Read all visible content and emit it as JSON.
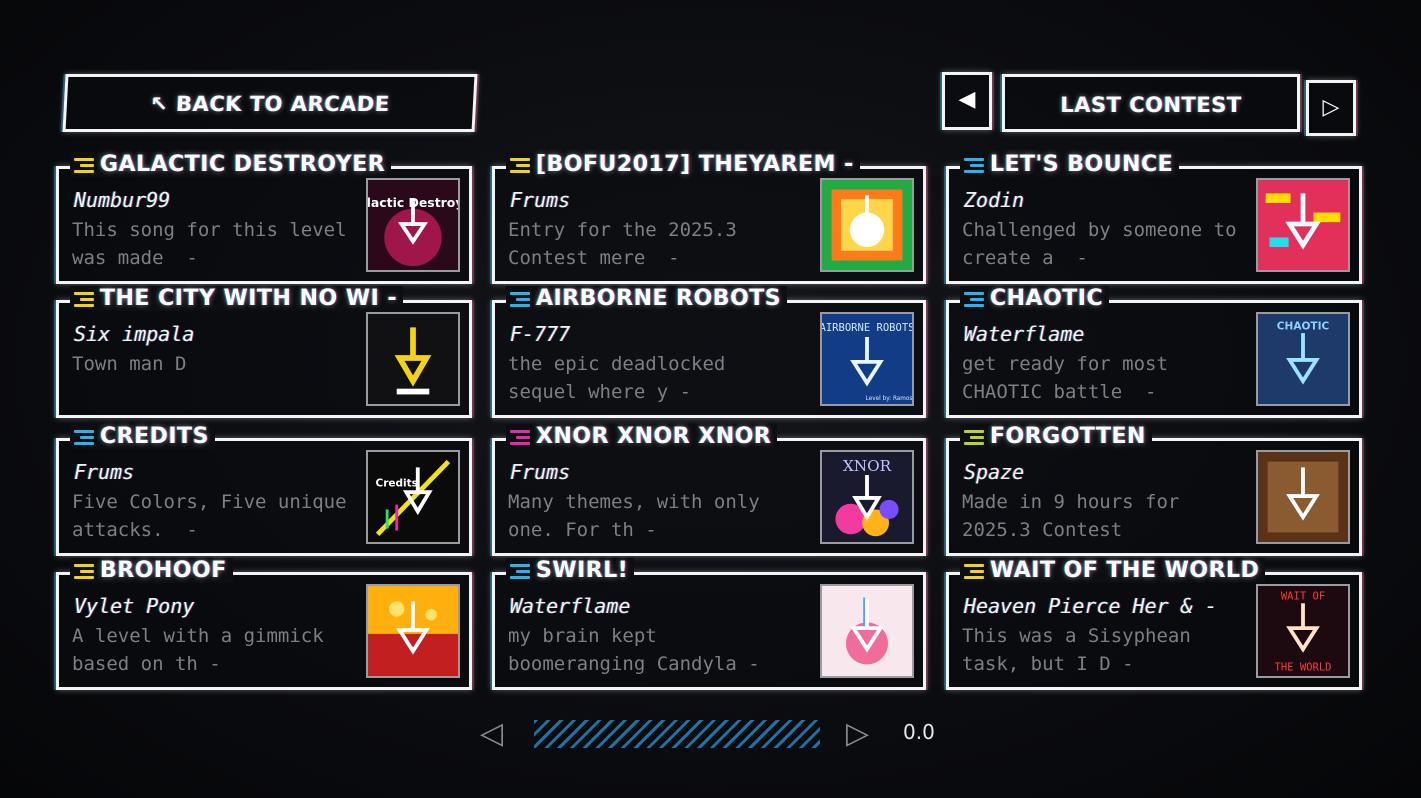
{
  "top": {
    "back_label": "↖ BACK TO ARCADE",
    "prev_glyph": "◀",
    "contest_label": "LAST CONTEST",
    "next_glyph": "▷"
  },
  "levels": [
    {
      "title": "GALACTIC DESTROYER",
      "artist": "Numbur99",
      "desc": "This song for this level\nwas made  -",
      "icon_color": "#f2d21a",
      "art": "galactic"
    },
    {
      "title": "[BOFU2017] THEYAREM -",
      "artist": "Frums",
      "desc": "Entry for the 2025.3\nContest mere  -",
      "icon_color": "#f2d21a",
      "art": "bofu"
    },
    {
      "title": "LET'S BOUNCE",
      "artist": "Zodin",
      "desc": "Challenged by someone to\ncreate a  -",
      "icon_color": "#25b4f0",
      "art": "bounce"
    },
    {
      "title": "THE CITY WITH NO WI -",
      "artist": "Six impala",
      "desc": "Town man D",
      "icon_color": "#f2d21a",
      "art": "city"
    },
    {
      "title": "AIRBORNE ROBOTS",
      "artist": "F-777",
      "desc": "the epic deadlocked\nsequel where y -",
      "icon_color": "#25b4f0",
      "art": "airborne"
    },
    {
      "title": "CHAOTIC",
      "artist": "Waterflame",
      "desc": "get ready for most\nCHAOTIC battle  -",
      "icon_color": "#25b4f0",
      "art": "chaotic"
    },
    {
      "title": "CREDITS",
      "artist": "Frums",
      "desc": "Five Colors, Five unique\nattacks.  -",
      "icon_color": "#25b4f0",
      "art": "credits"
    },
    {
      "title": "XNOR XNOR XNOR",
      "artist": "Frums",
      "desc": "Many themes, with only\none. For th -",
      "icon_color": "#e52aa8",
      "art": "xnor"
    },
    {
      "title": "FORGOTTEN",
      "artist": "Spaze",
      "desc": "Made in 9 hours for\n2025.3 Contest",
      "icon_color": "#b8d424",
      "art": "forgotten"
    },
    {
      "title": "BROHOOF",
      "artist": "Vylet Pony",
      "desc": "A level with a gimmick\nbased on th -",
      "icon_color": "#f2d21a",
      "art": "brohoof"
    },
    {
      "title": "SWIRL!",
      "artist": "Waterflame",
      "desc": "my brain kept\nboomeranging Candyla -",
      "icon_color": "#25b4f0",
      "art": "swirl"
    },
    {
      "title": "WAIT OF THE WORLD",
      "artist": "Heaven Pierce Her & -",
      "desc": "This was a Sisyphean\ntask, but I D -",
      "icon_color": "#f2d21a",
      "art": "wait"
    }
  ],
  "art_text": {
    "galactic": "Galactic Destroyer",
    "airborne": "AIRBORNE ROBOTS",
    "airborne_credit": "Level by: Ramos",
    "chaotic": "CHAOTIC",
    "credits": "Credits",
    "xnor": "XNOR",
    "wait_top": "WAIT  OF",
    "wait_bottom": "THE WORLD"
  },
  "bottom": {
    "prev_glyph": "◁",
    "next_glyph": "▷",
    "zoom": "0.0"
  }
}
